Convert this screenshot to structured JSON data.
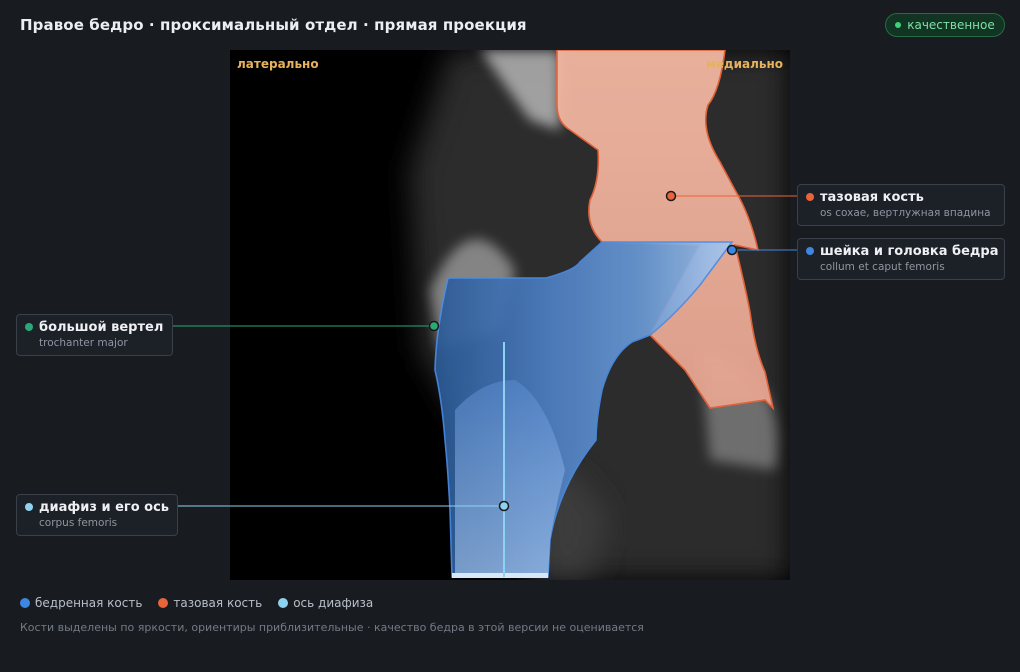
{
  "header": {
    "title": "Правое бедро · проксимальный отдел · прямая проекция",
    "badge": "качественное"
  },
  "image": {
    "label_left": "латерально",
    "label_right": "медиально"
  },
  "callouts": {
    "pelvis": {
      "title": "тазовая кость",
      "subtitle": "os coxae, вертлужная впадина",
      "color": "#e8643a"
    },
    "neck": {
      "title": "шейка и головка бедра",
      "subtitle": "collum et caput femoris",
      "color": "#3f86e0"
    },
    "trochanter": {
      "title": "большой вертел",
      "subtitle": "trochanter major",
      "color": "#2aa876"
    },
    "shaft": {
      "title": "диафиз и его ось",
      "subtitle": "corpus femoris",
      "color": "#8ed2f2"
    }
  },
  "legend": [
    {
      "label": "бедренная кость",
      "color": "#3f86e0"
    },
    {
      "label": "тазовая кость",
      "color": "#e8643a"
    },
    {
      "label": "ось диафиза",
      "color": "#8ed2f2"
    }
  ],
  "footnote": "Кости выделены по яркости, ориентиры приблизительные · качество бедра в этой версии не оценивается"
}
